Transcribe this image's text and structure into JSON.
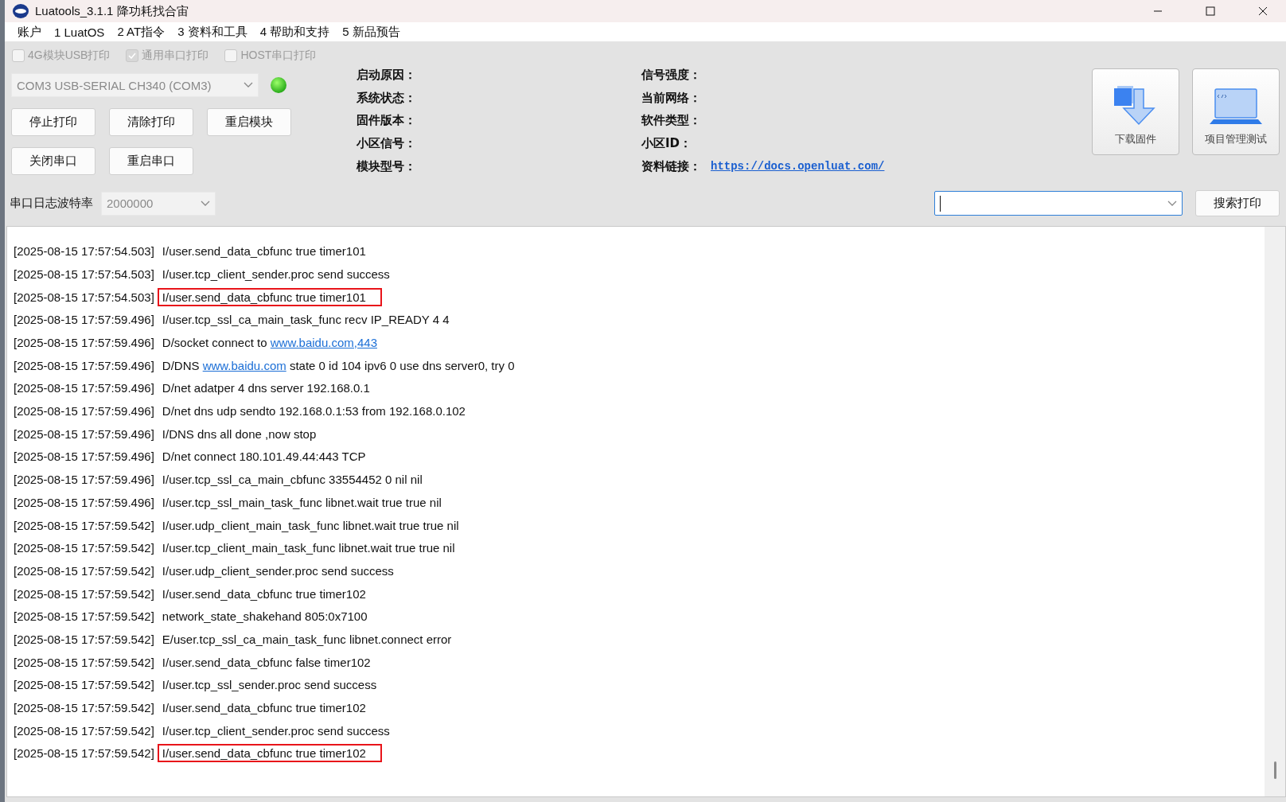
{
  "window": {
    "title": "Luatools_3.1.1 降功耗找合宙"
  },
  "menu": [
    "账户",
    "1 LuatOS",
    "2 AT指令",
    "3 资料和工具",
    "4 帮助和支持",
    "5 新品预告"
  ],
  "print_options": [
    {
      "label": "4G模块USB打印",
      "checked": false,
      "disabled": true
    },
    {
      "label": "通用串口打印",
      "checked": true,
      "disabled": true
    },
    {
      "label": "HOST串口打印",
      "checked": false,
      "disabled": true
    }
  ],
  "port_select": {
    "value": "COM3 USB-SERIAL CH340 (COM3)"
  },
  "buttons": [
    [
      "停止打印",
      "清除打印",
      "重启模块"
    ],
    [
      "关闭串口",
      "重启串口"
    ]
  ],
  "info": [
    {
      "label": "启动原因："
    },
    {
      "label": "系统状态："
    },
    {
      "label": "固件版本："
    },
    {
      "label": "小区信号："
    },
    {
      "label": "模块型号："
    }
  ],
  "info_right": [
    {
      "label": "信号强度："
    },
    {
      "label": "当前网络："
    },
    {
      "label": "软件类型："
    },
    {
      "label": "小区ID："
    },
    {
      "label": "资料链接：",
      "link": "https://docs.openluat.com/"
    }
  ],
  "big_buttons": [
    {
      "kind": "download",
      "label": "下载固件"
    },
    {
      "kind": "project",
      "label": "项目管理测试"
    }
  ],
  "baud": {
    "label": "串口日志波特率",
    "value": "2000000"
  },
  "search_button": "搜索打印",
  "log": [
    {
      "time": "[2025-08-15 17:57:54.503]",
      "highlighted": false,
      "parts": [
        {
          "kind": "plain",
          "text": "I/user.send_data_cbfunc true timer101"
        }
      ]
    },
    {
      "time": "[2025-08-15 17:57:54.503]",
      "highlighted": false,
      "parts": [
        {
          "kind": "plain",
          "text": "I/user.tcp_client_sender.proc send success"
        }
      ]
    },
    {
      "time": "[2025-08-15 17:57:54.503]",
      "highlighted": true,
      "parts": [
        {
          "kind": "plain",
          "text": "I/user.send_data_cbfunc true timer101"
        }
      ]
    },
    {
      "time": "[2025-08-15 17:57:59.496]",
      "highlighted": false,
      "parts": [
        {
          "kind": "plain",
          "text": "I/user.tcp_ssl_ca_main_task_func recv IP_READY 4 4"
        }
      ]
    },
    {
      "time": "[2025-08-15 17:57:59.496]",
      "highlighted": false,
      "parts": [
        {
          "kind": "plain",
          "text": "D/socket connect to "
        },
        {
          "kind": "link",
          "text": "www.baidu.com,443"
        }
      ]
    },
    {
      "time": "[2025-08-15 17:57:59.496]",
      "highlighted": false,
      "parts": [
        {
          "kind": "plain",
          "text": "D/DNS "
        },
        {
          "kind": "link",
          "text": "www.baidu.com"
        },
        {
          "kind": "plain",
          "text": " state 0 id 104 ipv6 0 use dns server0, try 0"
        }
      ]
    },
    {
      "time": "[2025-08-15 17:57:59.496]",
      "highlighted": false,
      "parts": [
        {
          "kind": "plain",
          "text": "D/net adatper 4 dns server 192.168.0.1"
        }
      ]
    },
    {
      "time": "[2025-08-15 17:57:59.496]",
      "highlighted": false,
      "parts": [
        {
          "kind": "plain",
          "text": "D/net dns udp sendto 192.168.0.1:53 from 192.168.0.102"
        }
      ]
    },
    {
      "time": "[2025-08-15 17:57:59.496]",
      "highlighted": false,
      "parts": [
        {
          "kind": "plain",
          "text": "I/DNS dns all done ,now stop"
        }
      ]
    },
    {
      "time": "[2025-08-15 17:57:59.496]",
      "highlighted": false,
      "parts": [
        {
          "kind": "plain",
          "text": "D/net connect 180.101.49.44:443 TCP"
        }
      ]
    },
    {
      "time": "[2025-08-15 17:57:59.496]",
      "highlighted": false,
      "parts": [
        {
          "kind": "plain",
          "text": "I/user.tcp_ssl_ca_main_cbfunc 33554452 0 nil nil"
        }
      ]
    },
    {
      "time": "[2025-08-15 17:57:59.496]",
      "highlighted": false,
      "parts": [
        {
          "kind": "plain",
          "text": "I/user.tcp_ssl_main_task_func libnet.wait true true nil"
        }
      ]
    },
    {
      "time": "[2025-08-15 17:57:59.542]",
      "highlighted": false,
      "parts": [
        {
          "kind": "plain",
          "text": "I/user.udp_client_main_task_func libnet.wait true true nil"
        }
      ]
    },
    {
      "time": "[2025-08-15 17:57:59.542]",
      "highlighted": false,
      "parts": [
        {
          "kind": "plain",
          "text": "I/user.tcp_client_main_task_func libnet.wait true true nil"
        }
      ]
    },
    {
      "time": "[2025-08-15 17:57:59.542]",
      "highlighted": false,
      "parts": [
        {
          "kind": "plain",
          "text": "I/user.udp_client_sender.proc send success"
        }
      ]
    },
    {
      "time": "[2025-08-15 17:57:59.542]",
      "highlighted": false,
      "parts": [
        {
          "kind": "plain",
          "text": "I/user.send_data_cbfunc true timer102"
        }
      ]
    },
    {
      "time": "[2025-08-15 17:57:59.542]",
      "highlighted": false,
      "parts": [
        {
          "kind": "plain",
          "text": "network_state_shakehand 805:0x7100"
        }
      ]
    },
    {
      "time": "[2025-08-15 17:57:59.542]",
      "highlighted": false,
      "parts": [
        {
          "kind": "plain",
          "text": "E/user.tcp_ssl_ca_main_task_func libnet.connect error"
        }
      ]
    },
    {
      "time": "[2025-08-15 17:57:59.542]",
      "highlighted": false,
      "parts": [
        {
          "kind": "plain",
          "text": "I/user.send_data_cbfunc false timer102"
        }
      ]
    },
    {
      "time": "[2025-08-15 17:57:59.542]",
      "highlighted": false,
      "parts": [
        {
          "kind": "plain",
          "text": "I/user.tcp_ssl_sender.proc send success"
        }
      ]
    },
    {
      "time": "[2025-08-15 17:57:59.542]",
      "highlighted": false,
      "parts": [
        {
          "kind": "plain",
          "text": "I/user.send_data_cbfunc true timer102"
        }
      ]
    },
    {
      "time": "[2025-08-15 17:57:59.542]",
      "highlighted": false,
      "parts": [
        {
          "kind": "plain",
          "text": "I/user.tcp_client_sender.proc send success"
        }
      ]
    },
    {
      "time": "[2025-08-15 17:57:59.542]",
      "highlighted": true,
      "parts": [
        {
          "kind": "plain",
          "text": "I/user.send_data_cbfunc true timer102"
        }
      ]
    }
  ]
}
